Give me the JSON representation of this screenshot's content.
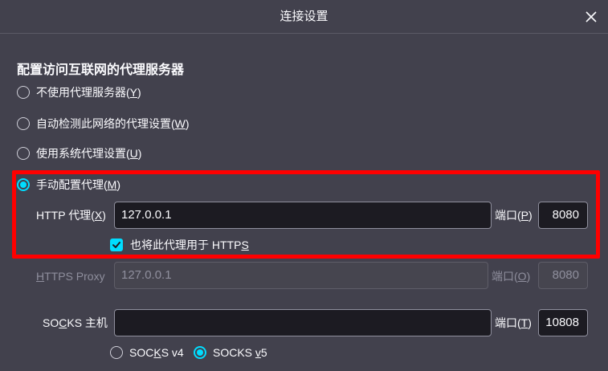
{
  "dialog": {
    "title": "连接设置",
    "section_title": "配置访问互联网的代理服务器"
  },
  "proxy_options": {
    "no_proxy": {
      "text": "不使用代理服务器(",
      "key": "Y",
      "tail": ")"
    },
    "auto_detect": {
      "text": "自动检测此网络的代理设置(",
      "key": "W",
      "tail": ")"
    },
    "system": {
      "text": "使用系统代理设置(",
      "key": "U",
      "tail": ")"
    },
    "manual": {
      "text": "手动配置代理(",
      "key": "M",
      "tail": ")"
    },
    "selected": "manual"
  },
  "http_proxy": {
    "label_text": "HTTP 代理(",
    "label_key": "X",
    "label_tail": ")",
    "value": "127.0.0.1",
    "port_label_text": "端口(",
    "port_label_key": "P",
    "port_label_tail": ")",
    "port": "8080"
  },
  "also_https": {
    "label_text": "也将此代理用于 HTTP",
    "label_key": "S",
    "checked": true
  },
  "https_proxy": {
    "label_key": "H",
    "label_text": "TTPS Proxy",
    "value": "127.0.0.1",
    "port_label_text": "端口(",
    "port_label_key": "O",
    "port_label_tail": ")",
    "port": "8080",
    "disabled": true
  },
  "socks": {
    "label_pre": "SO",
    "label_key": "C",
    "label_post": "KS 主机",
    "value": "",
    "port_label_text": "端口(",
    "port_label_key": "T",
    "port_label_tail": ")",
    "port": "10808",
    "v4_pre": "SOC",
    "v4_key": "K",
    "v4_post": "S v4",
    "v5_pre": "SOCKS ",
    "v5_key": "v",
    "v5_post": "5",
    "selected_version": "v5"
  },
  "colors": {
    "background": "#42414d",
    "accent": "#00ddff",
    "input_bg": "#1c1b22",
    "highlight": "#ff0000"
  }
}
